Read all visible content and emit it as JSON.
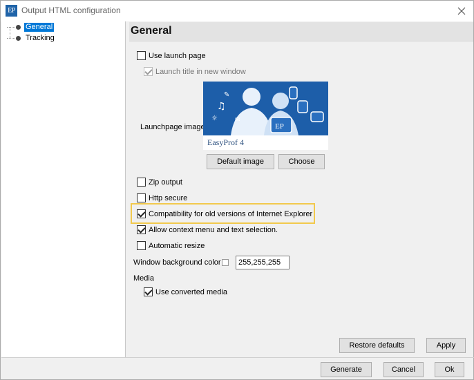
{
  "window": {
    "title": "Output HTML configuration",
    "app_icon_text": "EP"
  },
  "tree": {
    "items": [
      {
        "label": "General",
        "selected": true
      },
      {
        "label": "Tracking",
        "selected": false
      }
    ]
  },
  "panel": {
    "title": "General"
  },
  "options": {
    "use_launch_page": {
      "label": "Use launch page",
      "checked": false
    },
    "launch_title_new_window": {
      "label": "Launch title in new window",
      "checked": true,
      "disabled": true
    },
    "launchpage_image_label": "Launchpage image",
    "image_caption": "EasyProf 4",
    "default_image_button": "Default image",
    "choose_button": "Choose",
    "zip_output": {
      "label": "Zip output",
      "checked": false
    },
    "http_secure": {
      "label": "Http secure",
      "checked": false
    },
    "compat_ie": {
      "label": "Compatibility for old versions of Internet Explorer",
      "checked": true
    },
    "allow_context_menu": {
      "label": "Allow context menu and text selection.",
      "checked": true
    },
    "automatic_resize": {
      "label": "Automatic resize",
      "checked": false
    },
    "window_bg_color_label": "Window background color",
    "window_bg_color_value": "255,255,255",
    "media_label": "Media",
    "use_converted_media": {
      "label": "Use converted media",
      "checked": true
    }
  },
  "buttons": {
    "restore_defaults": "Restore defaults",
    "apply": "Apply",
    "generate": "Generate",
    "cancel": "Cancel",
    "ok": "Ok"
  },
  "colors": {
    "accent": "#0078d7",
    "highlight_border": "#f2c94c",
    "image_bg": "#1d5ea9"
  }
}
